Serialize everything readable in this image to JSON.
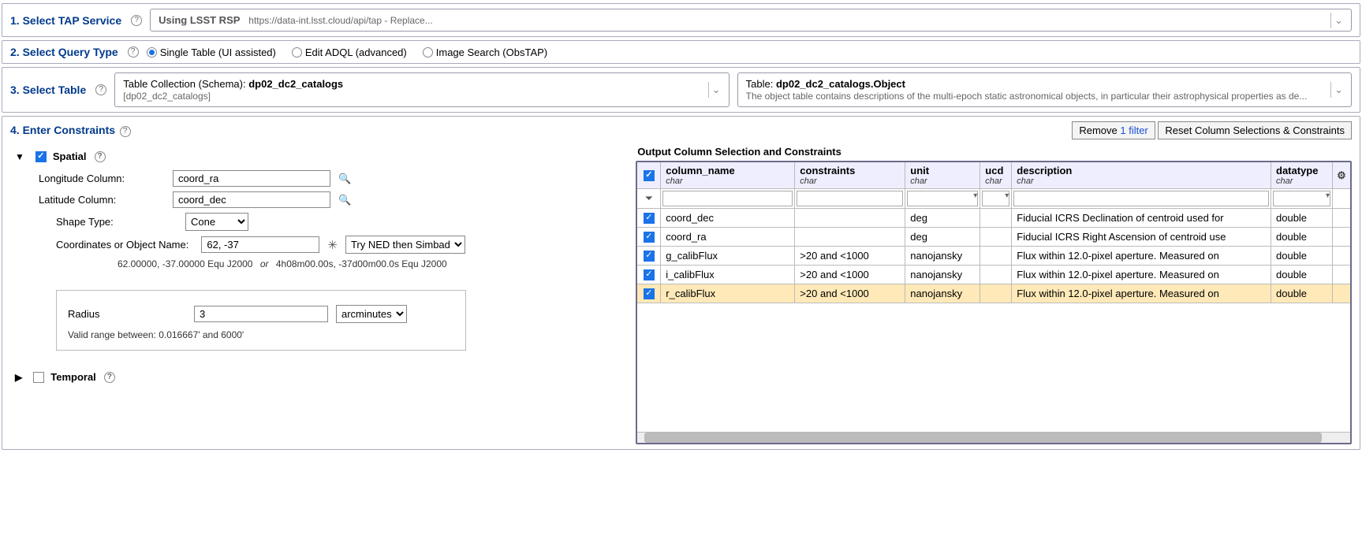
{
  "step1": {
    "label": "1. Select TAP Service",
    "tap_prefix": "Using LSST RSP",
    "tap_url": "https://data-int.lsst.cloud/api/tap - Replace..."
  },
  "step2": {
    "label": "2. Select Query Type",
    "opts": {
      "single": "Single Table (UI assisted)",
      "adql": "Edit ADQL (advanced)",
      "obstap": "Image Search (ObsTAP)"
    }
  },
  "step3": {
    "label": "3. Select Table",
    "schema_title": "Table Collection (Schema):",
    "schema_value": "dp02_dc2_catalogs",
    "schema_sub": "[dp02_dc2_catalogs]",
    "table_title": "Table:",
    "table_value": "dp02_dc2_catalogs.Object",
    "table_desc": "The object table contains descriptions of the multi-epoch static astronomical objects, in particular their astrophysical properties as de..."
  },
  "step4": {
    "label": "4. Enter Constraints",
    "remove_prefix": "Remove ",
    "remove_link": "1 filter",
    "reset": "Reset Column Selections & Constraints"
  },
  "spatial": {
    "title": "Spatial",
    "lon_label": "Longitude Column:",
    "lon_value": "coord_ra",
    "lat_label": "Latitude Column:",
    "lat_value": "coord_dec",
    "shape_label": "Shape Type:",
    "shape_value": "Cone",
    "coord_label": "Coordinates or Object Name:",
    "coord_value": "62, -37",
    "resolver": "Try NED then Simbad",
    "hint_a": "62.00000, -37.00000  Equ J2000",
    "hint_or": "or",
    "hint_b": "4h08m00.00s, -37d00m00.0s  Equ J2000",
    "radius_label": "Radius",
    "radius_value": "3",
    "radius_unit": "arcminutes",
    "valid_range": "Valid range between: 0.016667' and 6000'"
  },
  "temporal": {
    "title": "Temporal"
  },
  "table": {
    "title": "Output Column Selection and Constraints",
    "headers": {
      "name": "column_name",
      "cons": "constraints",
      "unit": "unit",
      "ucd": "ucd",
      "desc": "description",
      "type": "datatype",
      "sub": "char"
    },
    "rows": [
      {
        "name": "coord_dec",
        "cons": "",
        "unit": "deg",
        "ucd": "",
        "desc": "Fiducial ICRS Declination of centroid used for",
        "type": "double",
        "hl": false
      },
      {
        "name": "coord_ra",
        "cons": "",
        "unit": "deg",
        "ucd": "",
        "desc": "Fiducial ICRS Right Ascension of centroid use",
        "type": "double",
        "hl": false
      },
      {
        "name": "g_calibFlux",
        "cons": ">20 and <1000",
        "unit": "nanojansky",
        "ucd": "",
        "desc": "Flux within 12.0-pixel aperture. Measured on",
        "type": "double",
        "hl": false
      },
      {
        "name": "i_calibFlux",
        "cons": ">20 and <1000",
        "unit": "nanojansky",
        "ucd": "",
        "desc": "Flux within 12.0-pixel aperture. Measured on",
        "type": "double",
        "hl": false
      },
      {
        "name": "r_calibFlux",
        "cons": ">20 and <1000",
        "unit": "nanojansky",
        "ucd": "",
        "desc": "Flux within 12.0-pixel aperture. Measured on",
        "type": "double",
        "hl": true
      }
    ]
  }
}
